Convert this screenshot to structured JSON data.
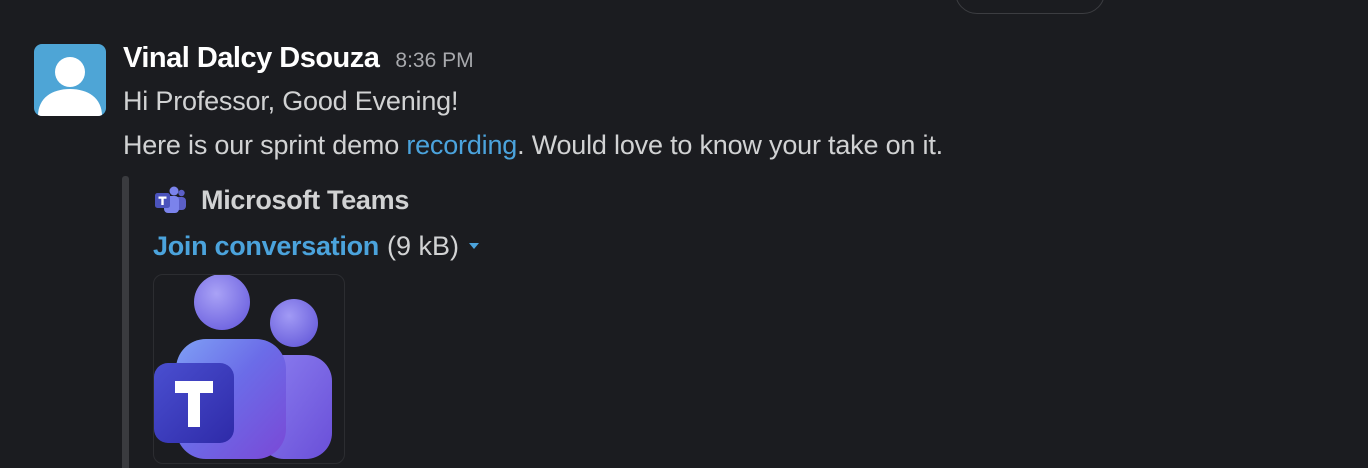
{
  "message": {
    "sender": "Vinal Dalcy Dsouza",
    "time": "8:36 PM",
    "line1": "Hi Professor, Good Evening!",
    "line2_before": "Here is our sprint demo ",
    "line2_link": "recording",
    "line2_after": ". Would love to know your take on it."
  },
  "attachment": {
    "app_name": "Microsoft Teams",
    "link_text": "Join conversation",
    "size": "(9 kB)",
    "icon": "microsoft-teams-icon"
  },
  "colors": {
    "background": "#1b1c20",
    "link": "#4ba3dc",
    "avatar_bg": "#4ea5d6",
    "teams_purple": "#5b5fc7"
  }
}
